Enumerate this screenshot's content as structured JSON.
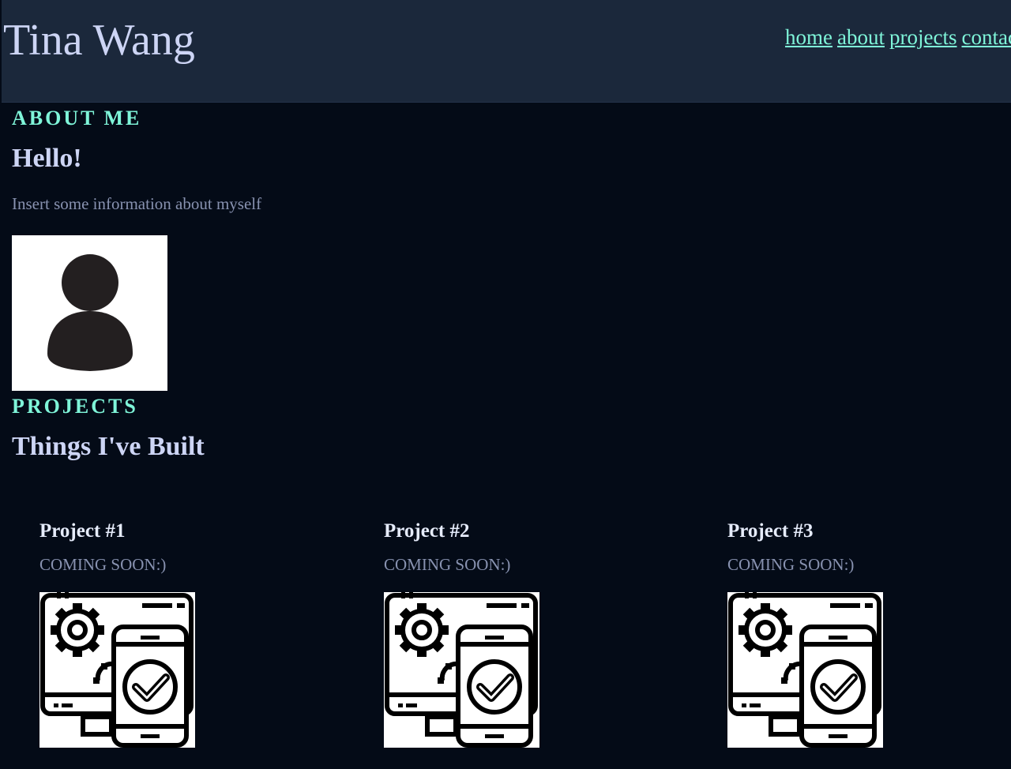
{
  "header": {
    "site_name": "Tina Wang",
    "nav": [
      "home",
      "about",
      "projects",
      "contact"
    ]
  },
  "about": {
    "label": "ABOUT ME",
    "title": "Hello!",
    "text": "Insert some information about myself",
    "photo_icon": "person-avatar-icon"
  },
  "projects": {
    "label": "PROJECTS",
    "title": "Things I've Built",
    "items": [
      {
        "title": "Project #1",
        "status": "COMING SOON:)",
        "icon": "app-development-icon"
      },
      {
        "title": "Project #2",
        "status": "COMING SOON:)",
        "icon": "app-development-icon"
      },
      {
        "title": "Project #3",
        "status": "COMING SOON:)",
        "icon": "app-development-icon"
      }
    ]
  },
  "colors": {
    "background": "#040b17",
    "header_bg": "#1b283b",
    "accent": "#7ff5d9",
    "heading": "#cdd5f5",
    "muted_text": "#8892b0"
  }
}
